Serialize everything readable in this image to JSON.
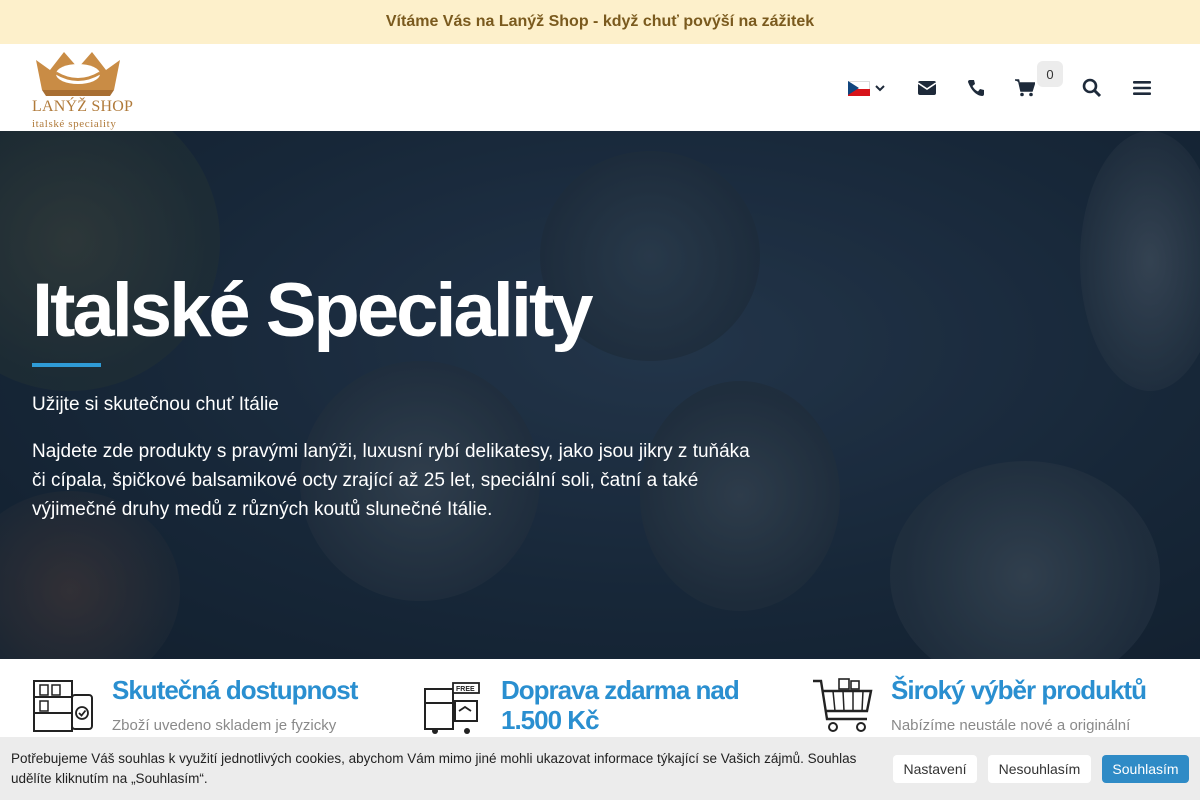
{
  "topbar": {
    "text": "Vítáme Vás na Lanýž Shop - když chuť povýší na zážitek"
  },
  "logo": {
    "brand": "LANÝŽ SHOP",
    "sub": "italské speciality"
  },
  "header": {
    "cart_count": "0",
    "icons": [
      "cz-flag-icon",
      "chevron-down-icon",
      "envelope-icon",
      "phone-icon",
      "cart-icon",
      "search-icon",
      "menu-icon"
    ]
  },
  "hero": {
    "title": "Italské Speciality",
    "tagline": "Užijte si skutečnou chuť Itálie",
    "description": "Najdete zde produkty s pravými lanýži, luxusní rybí delikatesy, jako jsou jikry z tuňáka či cípala, špičkové balsamikové octy zrající až 25 let, speciální soli, čatní a také výjimečné druhy medů z různých koutů slunečné Itálie."
  },
  "features": [
    {
      "title": "Skutečná dostupnost",
      "text": "Zboží uvedeno skladem je fyzicky",
      "icon": "warehouse-icon"
    },
    {
      "title": "Doprava zdarma nad 1.500 Kč",
      "text": "",
      "icon": "free-delivery-icon"
    },
    {
      "title": "Široký výběr produktů",
      "text": "Nabízíme neustále nové a originální",
      "icon": "shopping-cart-icon"
    }
  ],
  "cookie": {
    "text": "Potřebujeme Váš souhlas k využití jednotlivých cookies, abychom Vám mimo jiné mohli ukazovat informace týkající se Vašich zájmů. Souhlas udělíte kliknutím na „Souhlasím“.",
    "settings_label": "Nastavení",
    "decline_label": "Nesouhlasím",
    "accept_label": "Souhlasím"
  },
  "colors": {
    "accent": "#2f9bd6",
    "topbar_bg": "#fdf0cb",
    "brand_gold": "#b07a3a",
    "feature_title": "#2a8fd0"
  }
}
